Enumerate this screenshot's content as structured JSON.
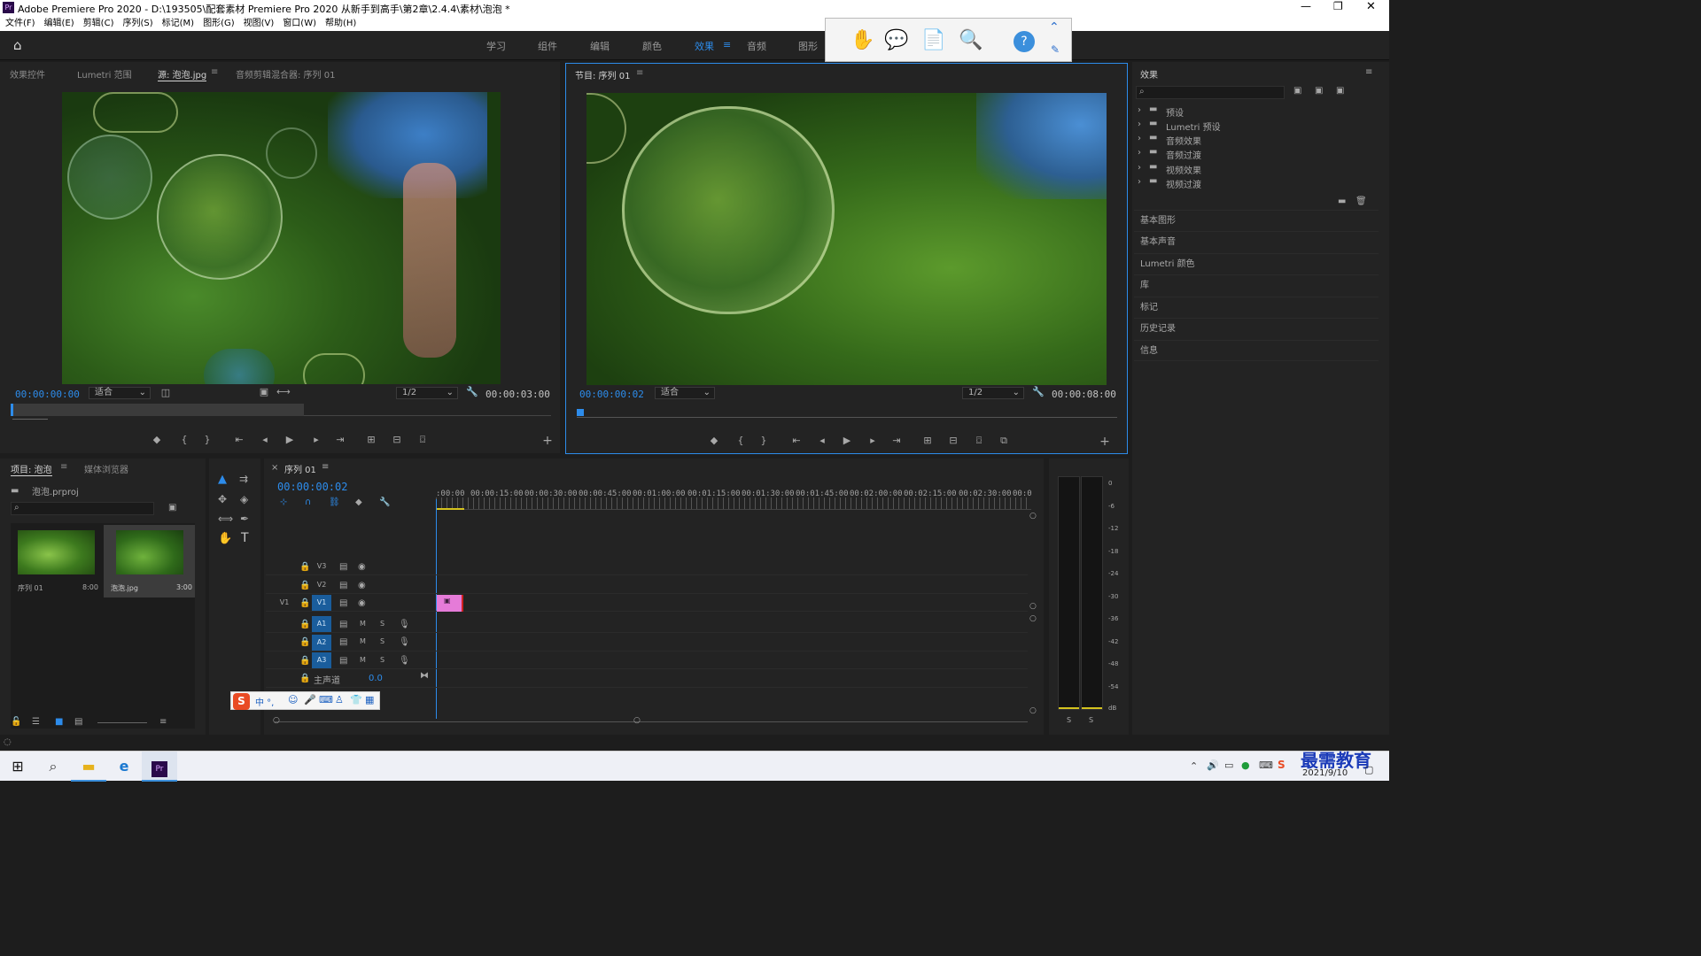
{
  "window": {
    "title": "Adobe Premiere Pro 2020 - D:\\193505\\配套素材 Premiere Pro 2020 从新手到高手\\第2章\\2.4.4\\素材\\泡泡 *",
    "app_icon": "Pr"
  },
  "menu": [
    "文件(F)",
    "编辑(E)",
    "剪辑(C)",
    "序列(S)",
    "标记(M)",
    "图形(G)",
    "视图(V)",
    "窗口(W)",
    "帮助(H)"
  ],
  "workspaces": {
    "items": [
      "学习",
      "组件",
      "编辑",
      "颜色",
      "效果",
      "音频",
      "图形"
    ],
    "active": "效果"
  },
  "source_panel": {
    "tabs": [
      "效果控件",
      "Lumetri 范围",
      "源: 泡泡.jpg",
      "音频剪辑混合器: 序列 01"
    ],
    "timecode": "00:00:00:00",
    "fit": "适合",
    "resolution": "1/2",
    "duration": "00:00:03:00"
  },
  "program_panel": {
    "tab": "节目: 序列 01",
    "timecode": "00:00:00:02",
    "fit": "适合",
    "resolution": "1/2",
    "duration": "00:00:08:00"
  },
  "effects_panel": {
    "title": "效果",
    "items": [
      "预设",
      "Lumetri 预设",
      "音频效果",
      "音频过渡",
      "视频效果",
      "视频过渡"
    ],
    "sections": [
      "基本图形",
      "基本声音",
      "Lumetri 颜色",
      "库",
      "标记",
      "历史记录",
      "信息"
    ]
  },
  "project_panel": {
    "tabs": [
      "项目: 泡泡",
      "媒体浏览器"
    ],
    "file": "泡泡.prproj",
    "items": [
      {
        "name": "序列 01",
        "duration": "8:00"
      },
      {
        "name": "泡泡.jpg",
        "duration": "3:00"
      }
    ]
  },
  "timeline": {
    "tab": "序列 01",
    "timecode": "00:00:00:02",
    "ruler": [
      ":00:00",
      "00:00:15:00",
      "00:00:30:00",
      "00:00:45:00",
      "00:01:00:00",
      "00:01:15:00",
      "00:01:30:00",
      "00:01:45:00",
      "00:02:00:00",
      "00:02:15:00",
      "00:02:30:00",
      "00:0"
    ],
    "video_tracks": [
      "V3",
      "V2",
      "V1"
    ],
    "audio_tracks": [
      "A1",
      "A2",
      "A3"
    ],
    "source_patch": "V1",
    "master": "主声道",
    "master_value": "0.0"
  },
  "meter": {
    "scale": [
      "0",
      "-6",
      "-12",
      "-18",
      "-24",
      "-30",
      "-36",
      "-42",
      "-48",
      "-54",
      "dB"
    ],
    "solo": [
      "S",
      "S"
    ]
  },
  "ime": {
    "text": "中 °,"
  },
  "taskbar": {
    "date": "2021/9/10",
    "watermark": "最需教育"
  }
}
